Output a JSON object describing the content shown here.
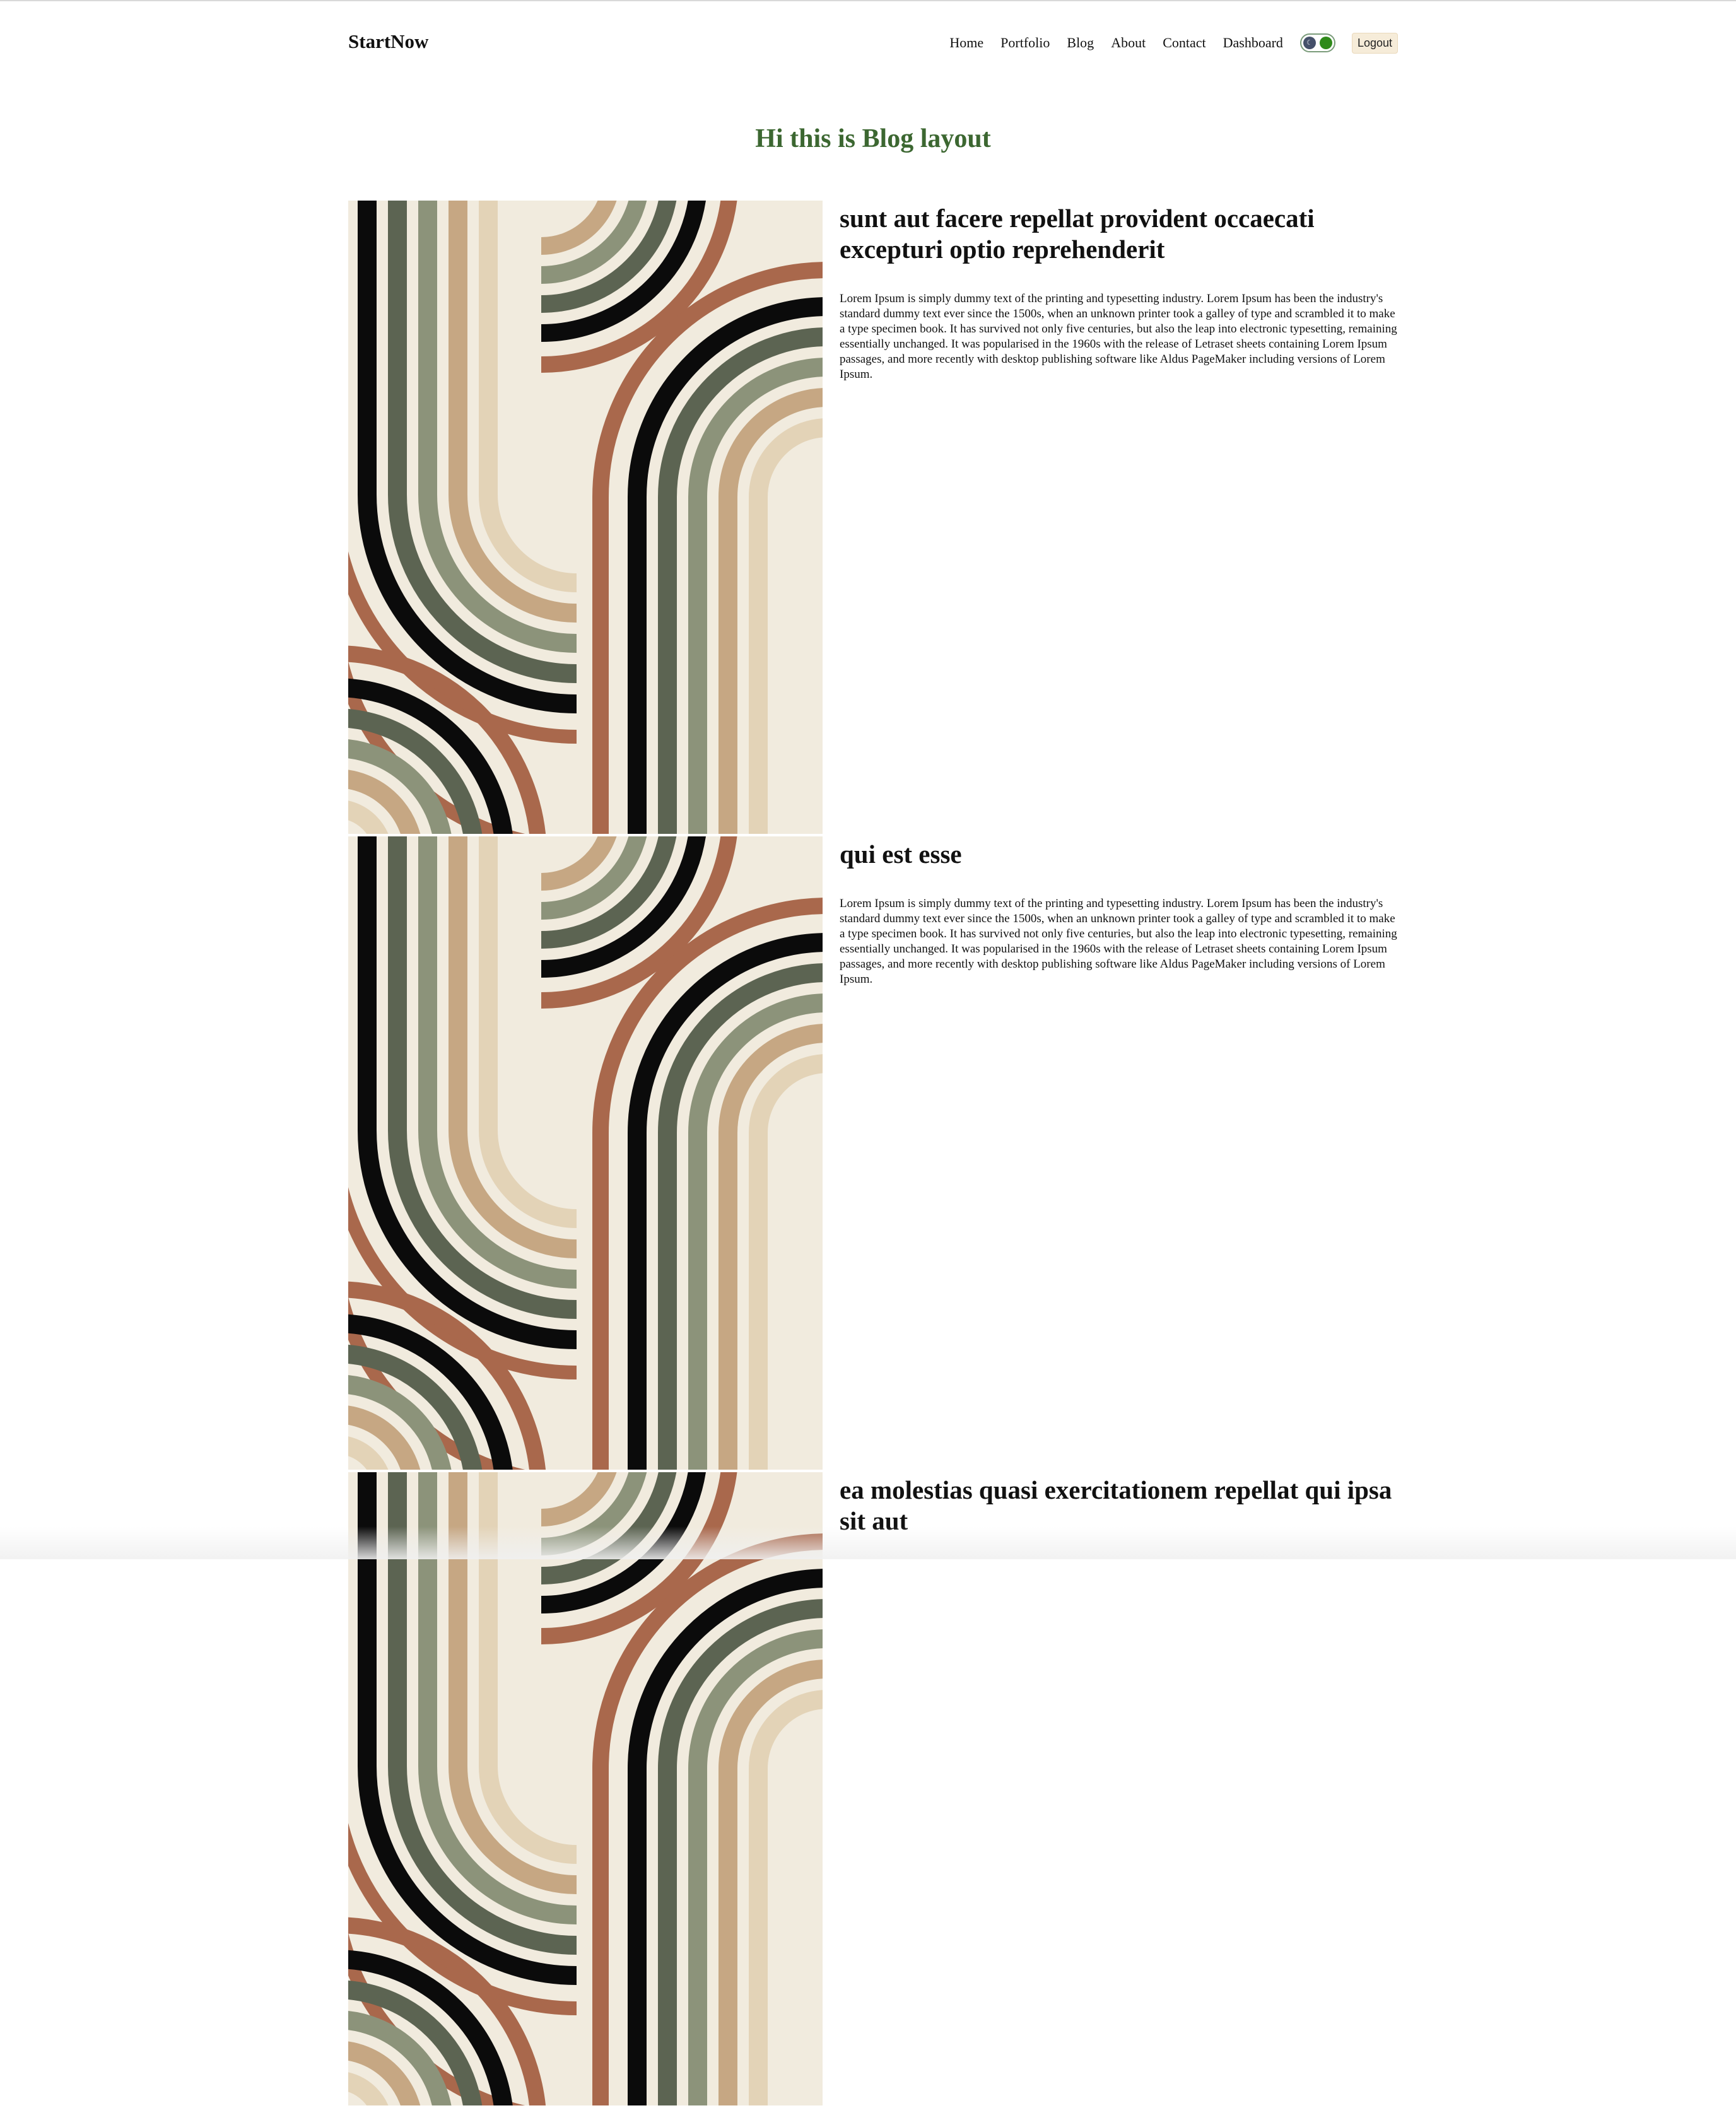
{
  "nav": {
    "logo": "StartNow",
    "links": [
      "Home",
      "Portfolio",
      "Blog",
      "About",
      "Contact",
      "Dashboard"
    ],
    "theme_toggle": {
      "icon_left": "moon-icon",
      "icon_right": "sun-icon",
      "moon_glyph": "☾"
    },
    "logout_label": "Logout"
  },
  "main": {
    "title": "Hi this is Blog layout",
    "posts": [
      {
        "title": "sunt aut facere repellat provident occaecati excepturi optio reprehenderit",
        "body": "Lorem Ipsum is simply dummy text of the printing and typesetting industry. Lorem Ipsum has been the industry's standard dummy text ever since the 1500s, when an unknown printer took a galley of type and scrambled it to make a type specimen book. It has survived not only five centuries, but also the leap into electronic typesetting, remaining essentially unchanged. It was popularised in the 1960s with the release of Letraset sheets containing Lorem Ipsum passages, and more recently with desktop publishing software like Aldus PageMaker including versions of Lorem Ipsum."
      },
      {
        "title": "qui est esse",
        "body": "Lorem Ipsum is simply dummy text of the printing and typesetting industry. Lorem Ipsum has been the industry's standard dummy text ever since the 1500s, when an unknown printer took a galley of type and scrambled it to make a type specimen book. It has survived not only five centuries, but also the leap into electronic typesetting, remaining essentially unchanged. It was popularised in the 1960s with the release of Letraset sheets containing Lorem Ipsum passages, and more recently with desktop publishing software like Aldus PageMaker including versions of Lorem Ipsum."
      },
      {
        "title": "ea molestias quasi exercitationem repellat qui ipsa sit aut",
        "body": ""
      }
    ]
  },
  "colors": {
    "title_green": "#3c6731",
    "logout_bg": "#f6ecd9",
    "toggle_sun": "#2f8a1a",
    "toggle_moon": "#45506a",
    "art_background": "#f1ebde",
    "art_bands": [
      "#a9684c",
      "#0b0b0b",
      "#5c6452",
      "#8c937a",
      "#c6a783",
      "#e3d3b7"
    ]
  }
}
